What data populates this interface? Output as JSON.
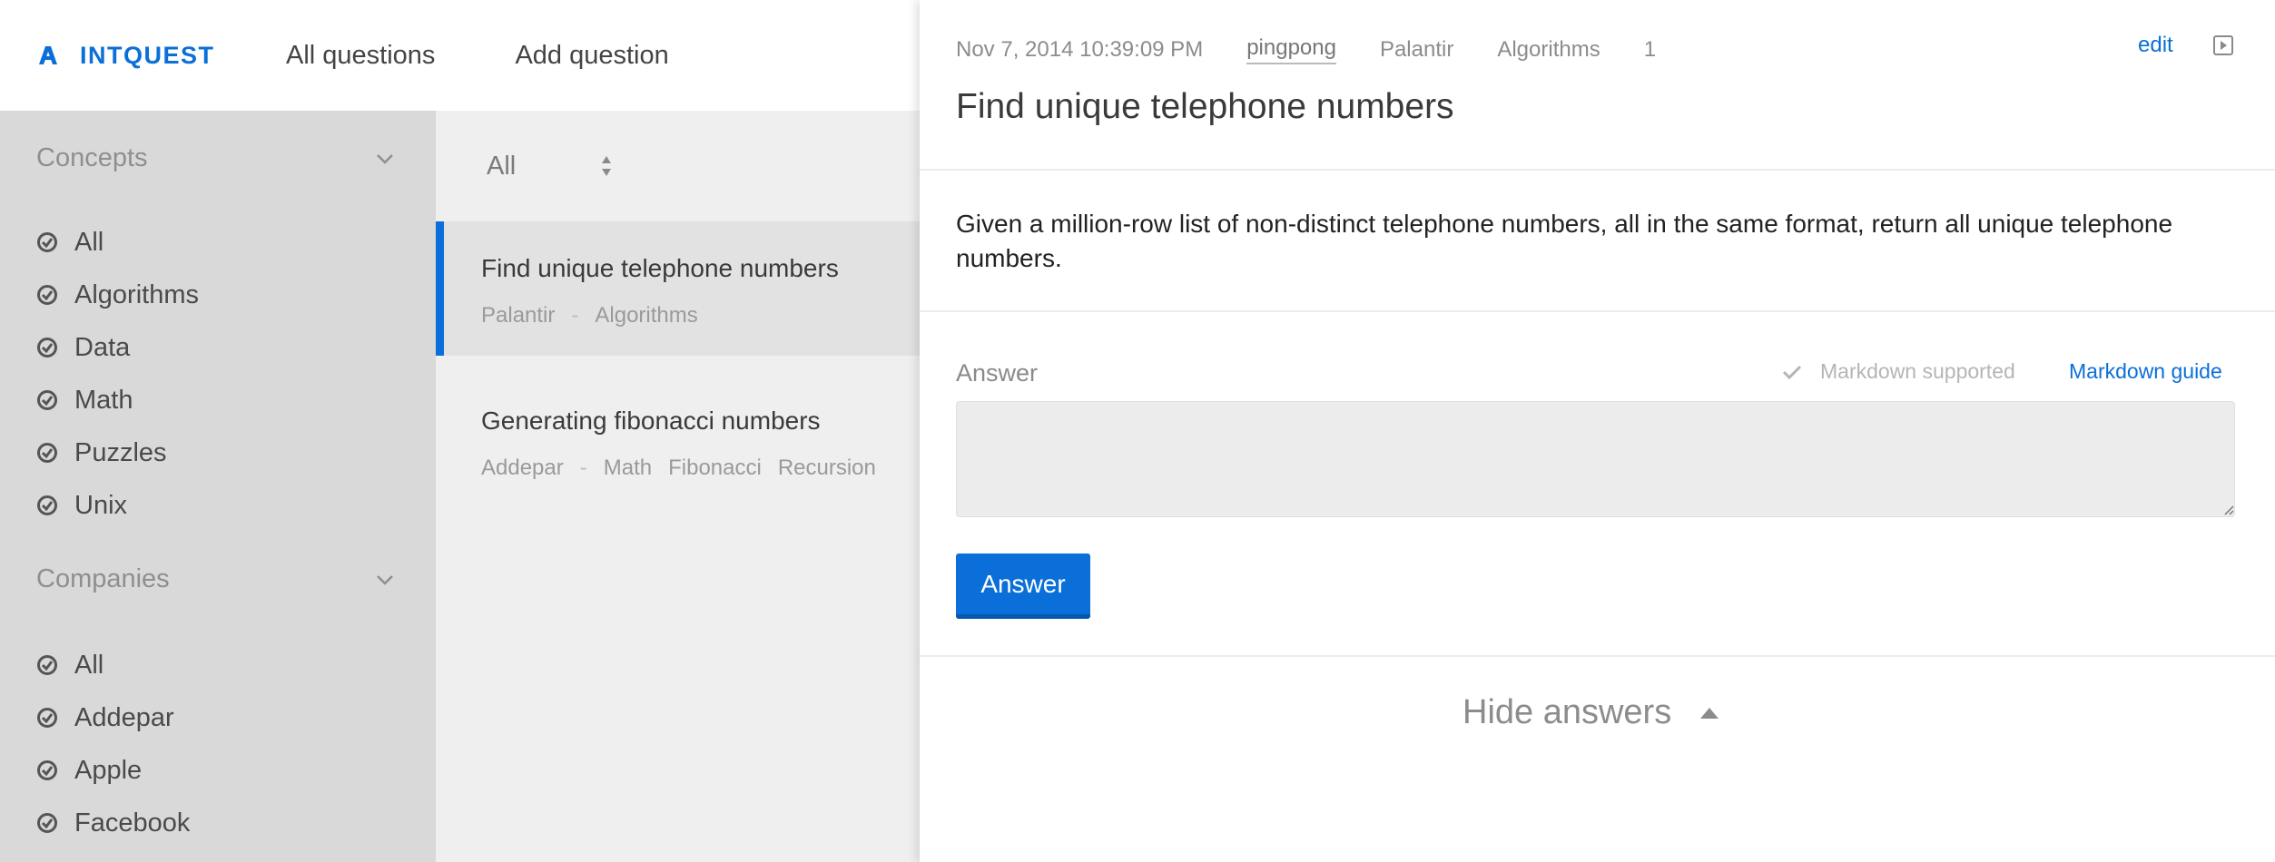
{
  "brand": {
    "name": "INTQUEST",
    "color": "#0a6fd8"
  },
  "topnav": {
    "links": [
      "All questions",
      "Add question"
    ]
  },
  "sidebar": {
    "concepts": {
      "title": "Concepts",
      "items": [
        "All",
        "Algorithms",
        "Data",
        "Math",
        "Puzzles",
        "Unix"
      ]
    },
    "companies": {
      "title": "Companies",
      "items": [
        "All",
        "Addepar",
        "Apple",
        "Facebook"
      ]
    }
  },
  "question_list": {
    "filter": {
      "selected": "All"
    },
    "items": [
      {
        "title": "Find unique telephone numbers",
        "company": "Palantir",
        "tags": [
          "Algorithms"
        ],
        "active": true
      },
      {
        "title": "Generating fibonacci numbers",
        "company": "Addepar",
        "tags": [
          "Math",
          "Fibonacci",
          "Recursion"
        ],
        "active": false
      }
    ]
  },
  "detail": {
    "date": "Nov 7, 2014 10:39:09 PM",
    "user": "pingpong",
    "company": "Palantir",
    "category": "Algorithms",
    "count": "1",
    "edit_label": "edit",
    "title": "Find unique telephone numbers",
    "body": "Given a million-row list of non-distinct telephone numbers, all in the same format, return all unique telephone numbers.",
    "answer_label": "Answer",
    "markdown_supported": "Markdown supported",
    "markdown_guide": "Markdown guide",
    "answer_placeholder": "",
    "answer_button": "Answer",
    "hide_answers": "Hide answers"
  },
  "icons": {
    "logo": "intquest-logo-icon",
    "check": "check-circle-icon",
    "chevron": "chevron-down-icon",
    "sort": "sort-updown-icon",
    "play": "play-box-icon",
    "tick": "checkmark-icon",
    "caret": "caret-up-icon"
  },
  "colors": {
    "accent": "#0a6fd8",
    "sidebar_bg": "#d9d9d9",
    "list_bg": "#efefef",
    "active_item_bg": "#e2e2e2"
  }
}
